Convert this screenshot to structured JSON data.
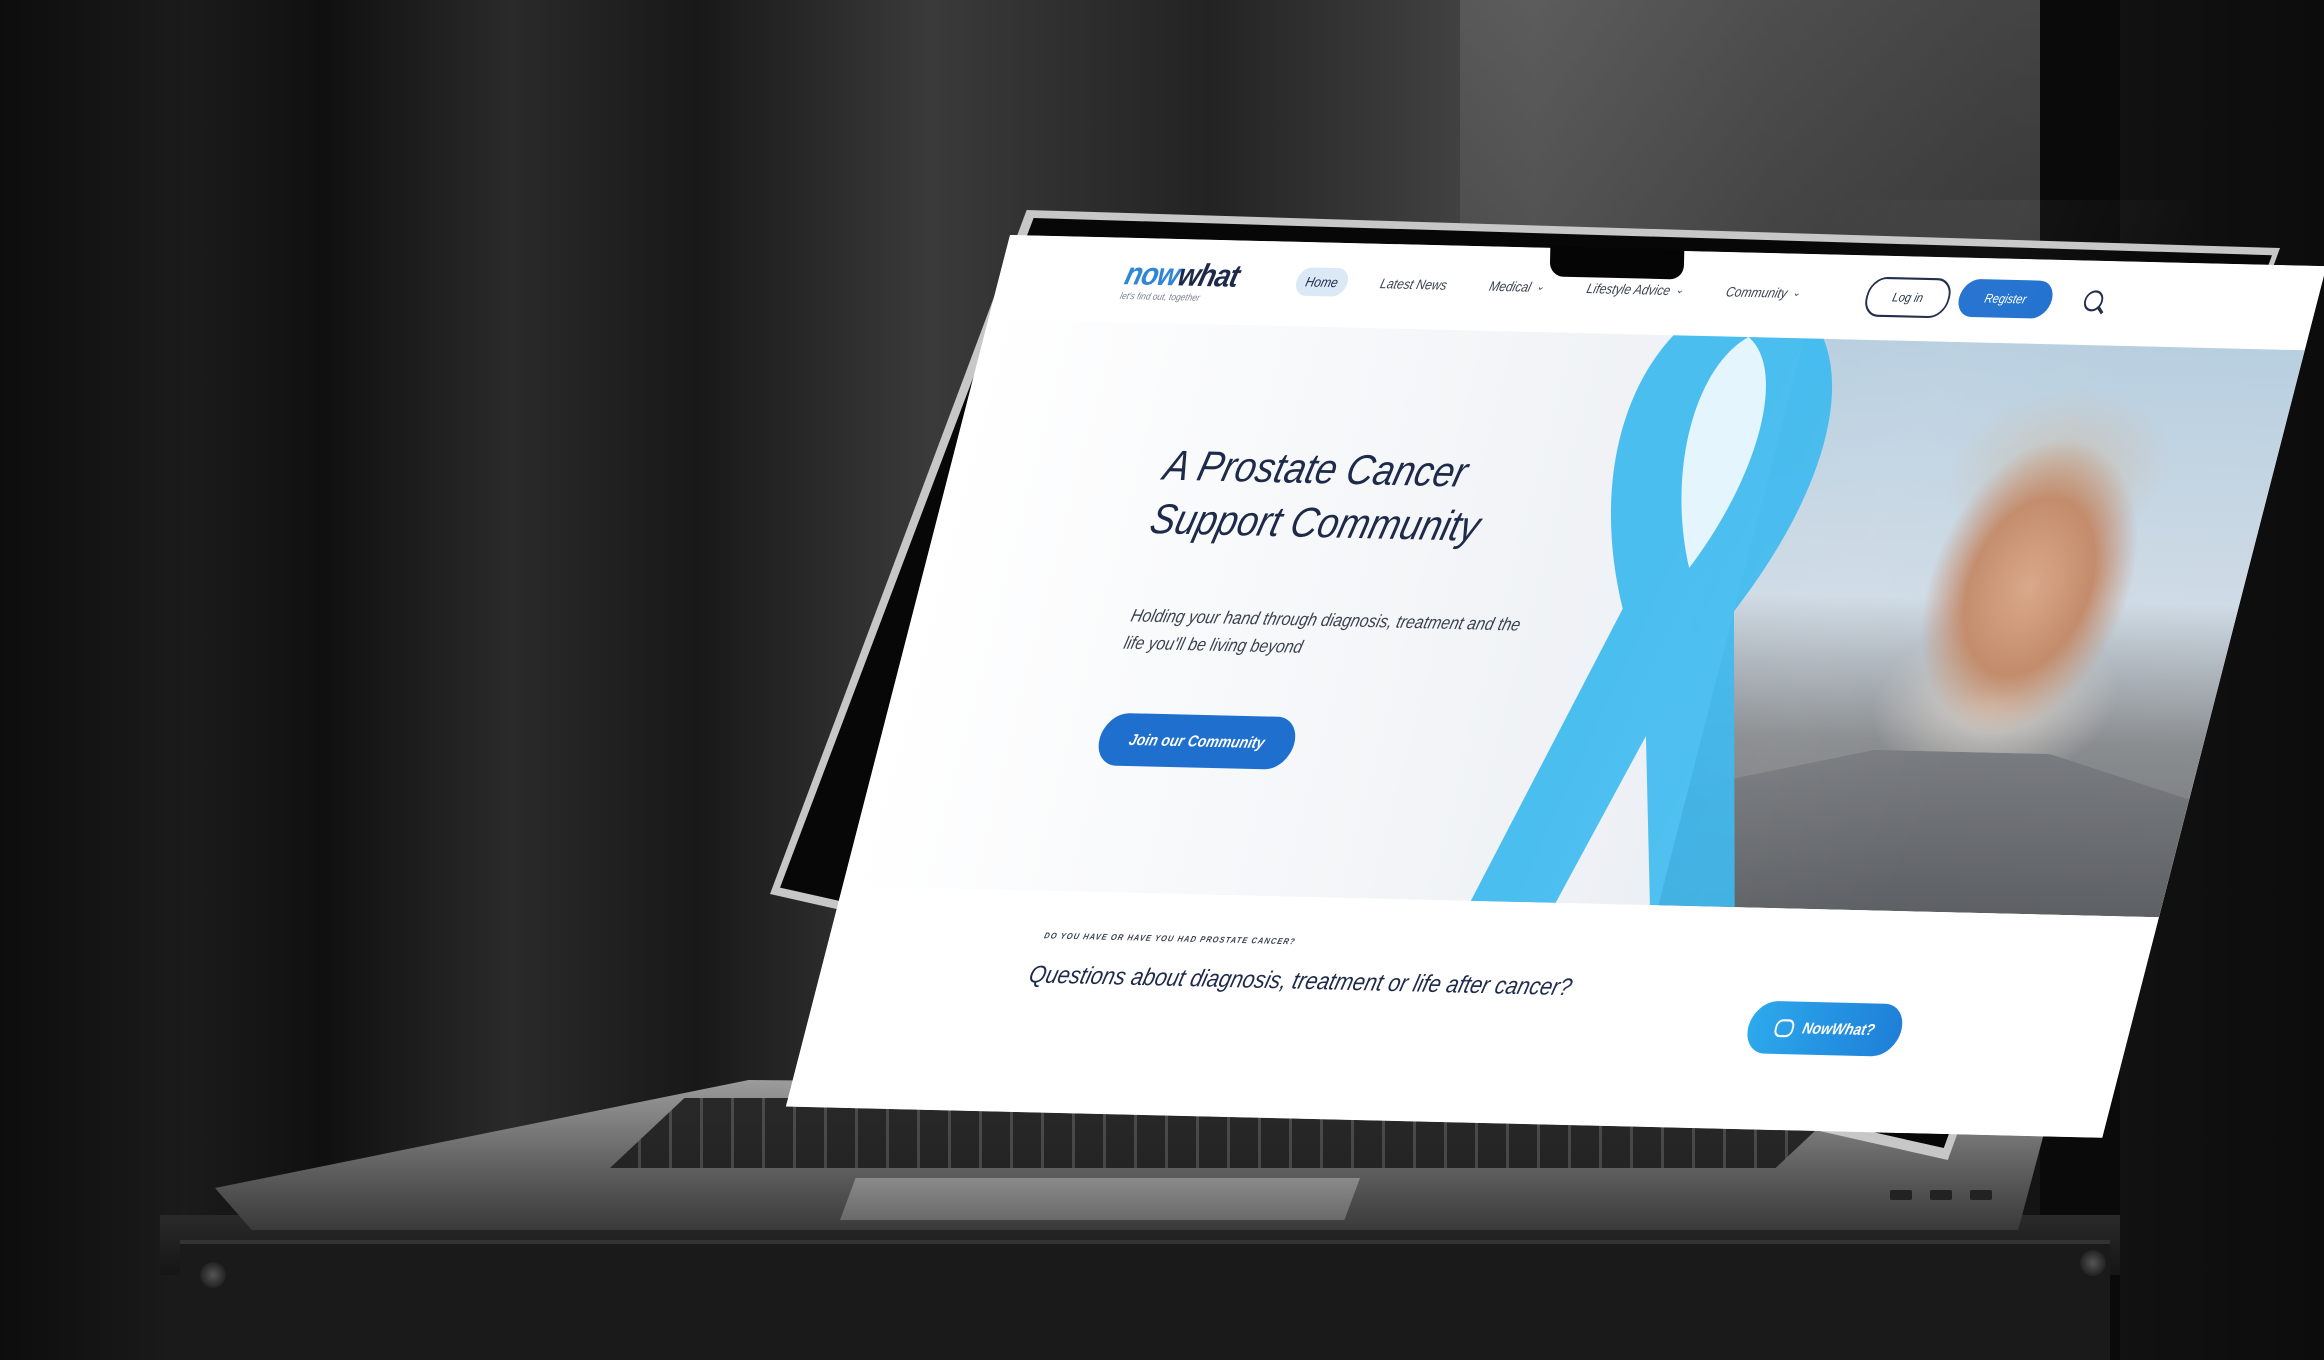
{
  "site": {
    "logo": {
      "now": "now",
      "what": "what",
      "tagline": "let's find out, together"
    },
    "nav": {
      "items": [
        {
          "label": "Home",
          "active": true
        },
        {
          "label": "Latest News",
          "active": false
        },
        {
          "label": "Medical",
          "active": false,
          "dropdown": true
        },
        {
          "label": "Lifestyle Advice",
          "active": false,
          "dropdown": true
        },
        {
          "label": "Community",
          "active": false,
          "dropdown": true
        }
      ],
      "login_label": "Log in",
      "register_label": "Register"
    },
    "hero": {
      "title": "A Prostate Cancer Support Community",
      "subtitle": "Holding your hand through diagnosis, treatment and the life you'll be living beyond",
      "cta_label": "Join our Community"
    },
    "section": {
      "kicker": "DO YOU HAVE OR HAVE YOU HAD PROSTATE CANCER?",
      "question": "Questions about diagnosis, treatment or life after cancer?",
      "chat_button_label": "NowWhat?"
    },
    "colors": {
      "brand_blue": "#1f6fcf",
      "ribbon_blue": "#38b8f0",
      "navy": "#1e2a4a"
    }
  }
}
